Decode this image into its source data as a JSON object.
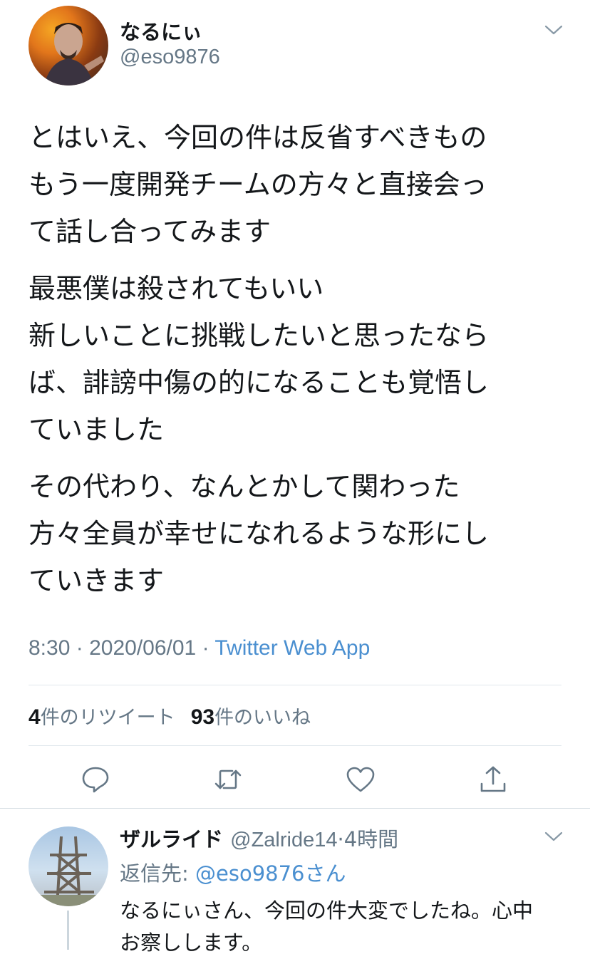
{
  "tweet": {
    "display_name": "なるにぃ",
    "handle": "@eso9876",
    "paragraphs": [
      [
        "とはいえ、今回の件は反省すべきもの",
        "もう一度開発チームの方々と直接会っ",
        "て話し合ってみます"
      ],
      [
        "最悪僕は殺されてもいい",
        "新しいことに挑戦したいと思ったなら",
        "ば、誹謗中傷の的になることも覚悟し",
        "ていました"
      ],
      [
        "その代わり、なんとかして関わった",
        "方々全員が幸せになれるような形にし",
        "ていきます"
      ]
    ],
    "time": "8:30",
    "date": "2020/06/01",
    "separator": "·",
    "source": "Twitter Web App",
    "retweet_count": "4",
    "retweet_label": "件のリツイート",
    "like_count": "93",
    "like_label": "件のいいね"
  },
  "actions": [
    "reply-icon",
    "retweet-icon",
    "like-icon",
    "share-icon"
  ],
  "reply": {
    "display_name": "ザルライド",
    "handle": "@Zalride14",
    "separator": "·",
    "time_ago": "4時間",
    "reply_to_label": "返信先: ",
    "reply_to_mention": "@eso9876さん",
    "text_lines": [
      "なるにぃさん、今回の件大変でしたね。心中",
      "お察しします。"
    ]
  },
  "colors": {
    "text": "#14171a",
    "secondary": "#657786",
    "link": "#4a8fd0",
    "divider": "#e1e8ed"
  }
}
